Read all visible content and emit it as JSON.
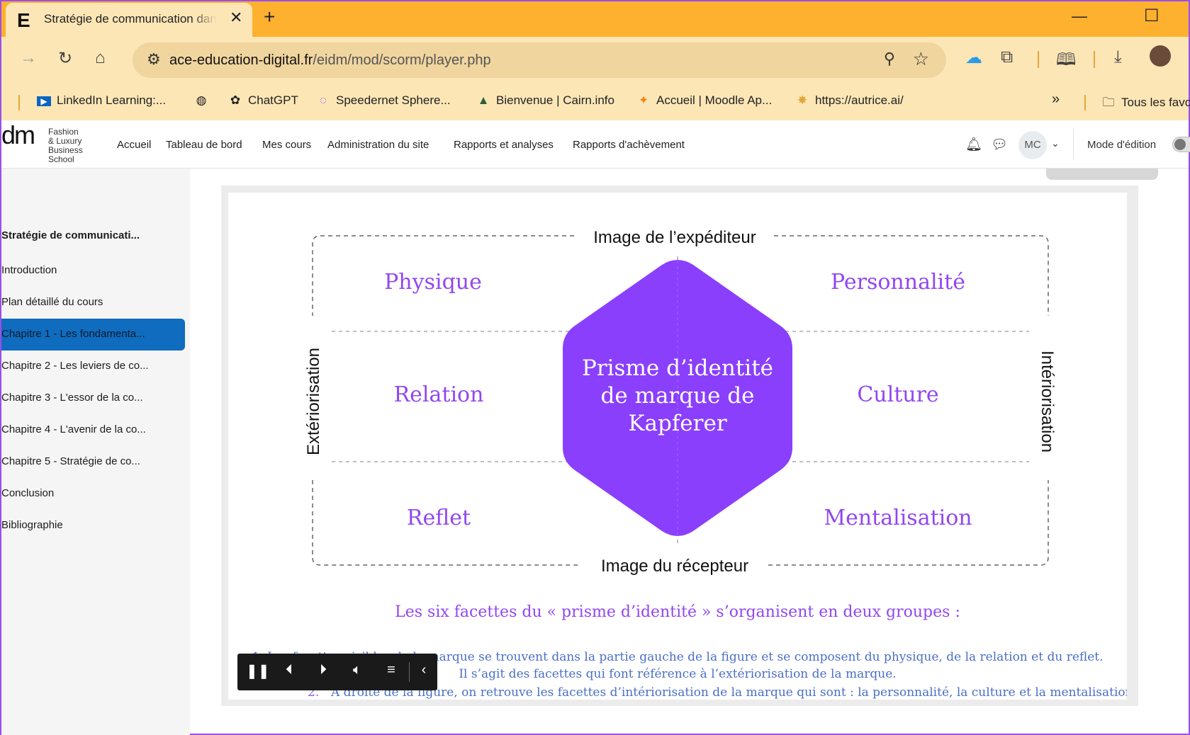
{
  "browser": {
    "tab_title": "Stratégie de communication dans le luxe",
    "tab_favicon": "E",
    "new_tab": "+",
    "url_domain": "ace-education-digital.fr",
    "url_path": "/eidm/mod/scorm/player.php",
    "bookmarks": [
      {
        "label": "LinkedIn Learning:...",
        "icon": "linkedin-icon"
      },
      {
        "label": "",
        "icon": "globe-icon"
      },
      {
        "label": "ChatGPT",
        "icon": "chatgpt-icon"
      },
      {
        "label": "Speedernet Sphere...",
        "icon": "sphere-icon"
      },
      {
        "label": "Bienvenue | Cairn.info",
        "icon": "cairn-icon"
      },
      {
        "label": "Accueil | Moodle Ap...",
        "icon": "moodle-icon"
      },
      {
        "label": "https://autrice.ai/",
        "icon": "autrice-icon"
      }
    ],
    "more_bookmarks": "»",
    "all_bookmarks": "Tous les favoris"
  },
  "moodle": {
    "logo_mark": "dm",
    "logo_lines": [
      "Fashion",
      "& Luxury",
      "Business",
      "School"
    ],
    "nav": [
      "Accueil",
      "Tableau de bord",
      "Mes cours",
      "Administration du site",
      "Rapports et analyses",
      "Rapports d'achèvement"
    ],
    "user_initials": "MC",
    "edit_mode": "Mode d'édition"
  },
  "sidebar": {
    "course_title": "Stratégie de communicati...",
    "items": [
      {
        "label": "Introduction",
        "active": false
      },
      {
        "label": "Plan détaillé du cours",
        "active": false
      },
      {
        "label": "Chapitre 1 - Les fondamenta...",
        "active": true
      },
      {
        "label": "Chapitre 2 - Les leviers de co...",
        "active": false
      },
      {
        "label": "Chapitre 3 - L'essor de la co...",
        "active": false
      },
      {
        "label": "Chapitre 4 - L'avenir de la co...",
        "active": false
      },
      {
        "label": "Chapitre 5 - Stratégie de co...",
        "active": false
      },
      {
        "label": "Conclusion",
        "active": false
      },
      {
        "label": "Bibliographie",
        "active": false
      }
    ]
  },
  "slide": {
    "top_label": "Image de l’expéditeur",
    "bottom_label": "Image du récepteur",
    "left_label": "Extériorisation",
    "right_label": "Intériorisation",
    "center_lines": [
      "Prisme d’identité",
      "de marque de",
      "Kapferer"
    ],
    "facets": {
      "physique": "Physique",
      "personnalite": "Personnalité",
      "relation": "Relation",
      "culture": "Culture",
      "reflet": "Reflet",
      "mentalisation": "Mentalisation"
    },
    "caption": "Les six facettes du « prisme d’identité » s’organisent en deux groupes :",
    "bullet_1_line_1": "1. Les facettes visibles de la marque se trouvent dans la partie gauche de la figure et se composent du physique, de la relation et du reflet.",
    "bullet_1_line_2": "Il s’agit des facettes qui font référence à l’extériorisation de la marque.",
    "bullet_2_number": "2.",
    "bullet_2": "A droite de la figure, on retrouve les facettes d’intériorisation de la marque qui sont : la personnalité, la culture et la mentalisation."
  },
  "colors": {
    "accent_purple": "#8a3ffc",
    "facet_text": "#9147f0",
    "tab_strip": "#fdb12e",
    "toolbar": "#fde6b6",
    "active_item": "#0f6cbf"
  }
}
